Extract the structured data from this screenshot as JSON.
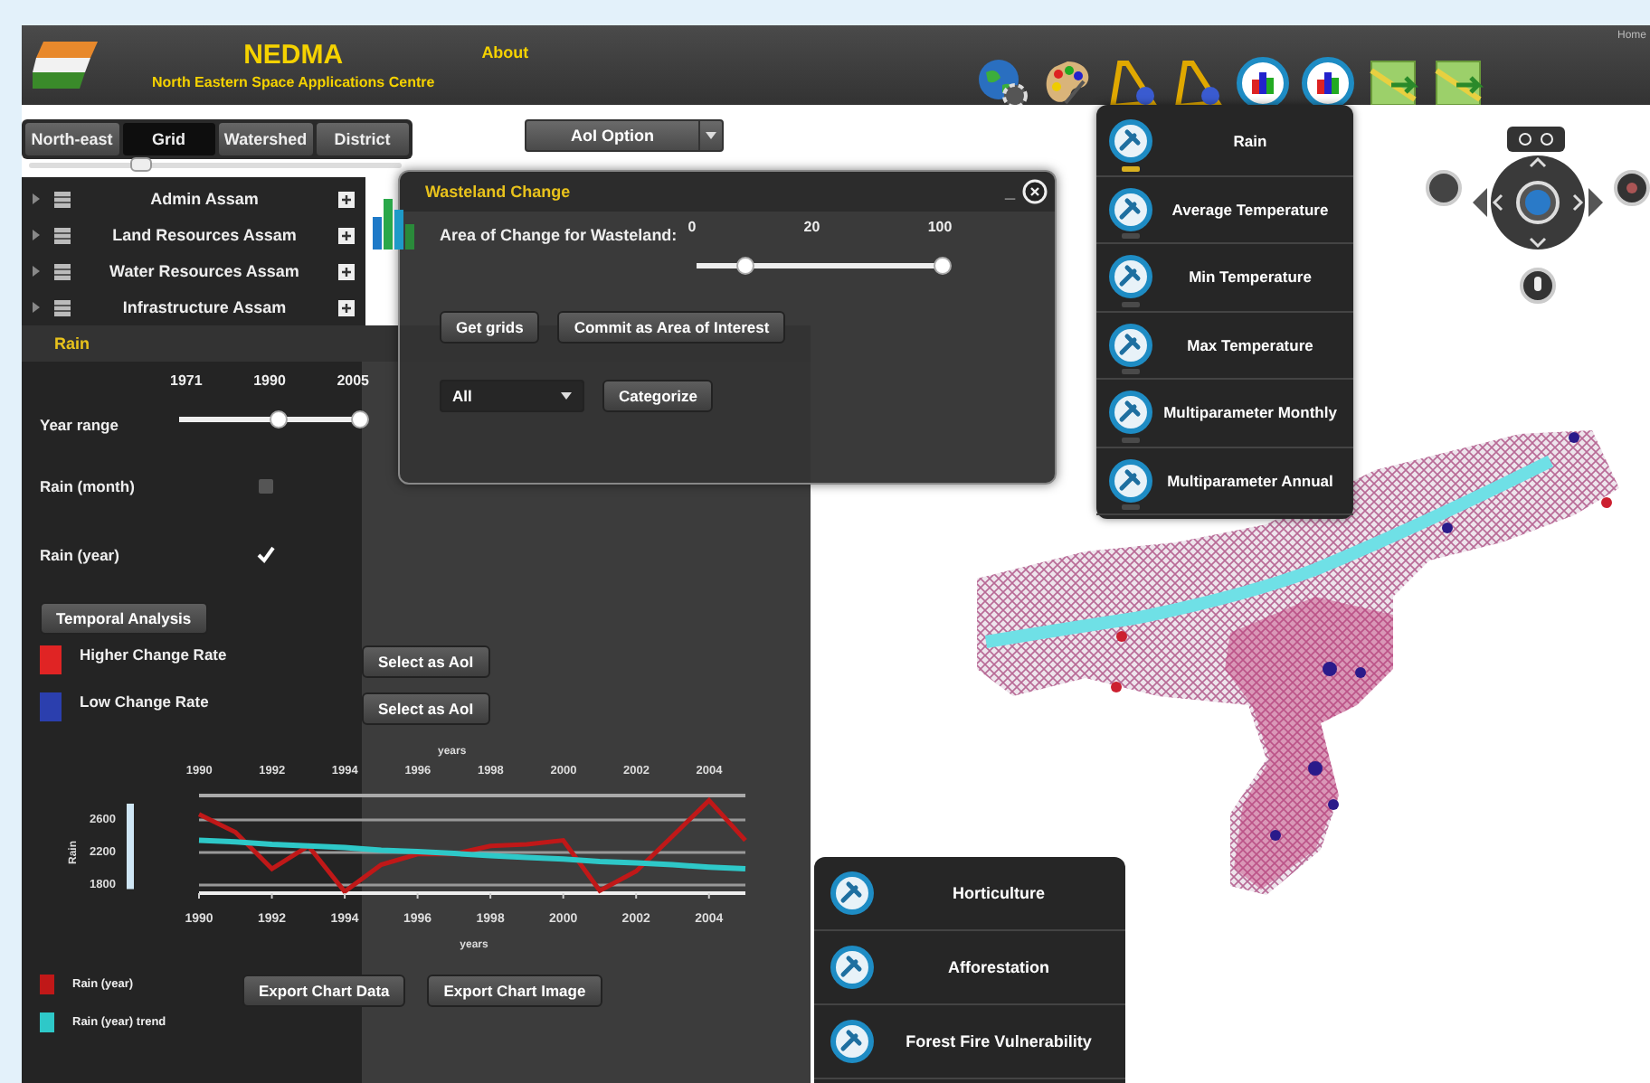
{
  "header": {
    "title": "NEDMA",
    "subtitle": "North Eastern Space Applications Centre",
    "about": "About",
    "home": "Home",
    "tools": [
      {
        "kind": "globe"
      },
      {
        "kind": "palette"
      },
      {
        "kind": "ruler"
      },
      {
        "kind": "ruler"
      },
      {
        "kind": "chart"
      },
      {
        "kind": "chart"
      },
      {
        "kind": "map"
      },
      {
        "kind": "map"
      }
    ]
  },
  "layer_tabs": [
    {
      "label": "North-east",
      "selected": false
    },
    {
      "label": "Grid",
      "selected": true
    },
    {
      "label": "Watershed",
      "selected": false
    },
    {
      "label": "District",
      "selected": false
    }
  ],
  "tabs_slider": {
    "level": 0.3
  },
  "layers": [
    {
      "label": "Admin Assam"
    },
    {
      "label": "Land Resources Assam"
    },
    {
      "label": "Water Resources Assam"
    },
    {
      "label": "Infrastructure Assam"
    }
  ],
  "aoi_option": {
    "label": "AoI Option"
  },
  "wasteland": {
    "title": "Wasteland Change",
    "minimize": "_",
    "label": "Area of Change for Wasteland:",
    "ticks": [
      "0",
      "20",
      "100"
    ],
    "thumbs": [
      {
        "level": 0.2
      },
      {
        "level": 1
      }
    ],
    "buttons": [
      "Get grids",
      "Commit as Area of Interest"
    ],
    "category": "All",
    "categorize": "Categorize"
  },
  "rain": {
    "title": "Rain",
    "ticks": [
      "1971",
      "1990",
      "2005"
    ],
    "year_range": "Year range",
    "thumbs": [
      {
        "level": 0.55
      },
      {
        "level": 1
      }
    ],
    "options": [
      {
        "label": "Rain (month)",
        "checked": false
      },
      {
        "label": "Rain (year)",
        "checked": true
      }
    ],
    "temporal": "Temporal Analysis",
    "change_legend": [
      {
        "label": "Higher Change Rate",
        "color": "#e02424",
        "action": "Select as AoI"
      },
      {
        "label": "Low Change Rate",
        "color": "#2b3fae",
        "action": "Select as AoI"
      }
    ],
    "top_xlabel": "years",
    "top_ticks": [
      "1990",
      "1992",
      "1994",
      "1996",
      "1998",
      "2000",
      "2002",
      "2004"
    ],
    "chart_data": {
      "type": "line",
      "xlabel": "years",
      "ylabel": "Rain",
      "x": [
        1990,
        1991,
        1992,
        1993,
        1994,
        1995,
        1996,
        1997,
        1998,
        1999,
        2000,
        2001,
        2002,
        2003,
        2004,
        2005
      ],
      "series": [
        {
          "name": "Rain (year)",
          "color": "#c01818",
          "values": [
            2670,
            2450,
            2000,
            2280,
            1720,
            2050,
            2180,
            2180,
            2280,
            2300,
            2350,
            1730,
            1970,
            2400,
            2840,
            2350
          ]
        },
        {
          "name": "Rain (year) trend",
          "color": "#2ec8c8",
          "values": [
            2350,
            2330,
            2300,
            2280,
            2260,
            2230,
            2210,
            2190,
            2160,
            2140,
            2120,
            2090,
            2070,
            2050,
            2020,
            2000
          ]
        }
      ],
      "xlim": [
        1990,
        2005
      ],
      "ylim": [
        1700,
        2900
      ],
      "xticks": [
        1990,
        1992,
        1994,
        1996,
        1998,
        2000,
        2002,
        2004
      ],
      "yticks": [
        1800,
        2200,
        2600
      ],
      "grid": true
    },
    "exports": [
      "Export Chart Data",
      "Export Chart Image"
    ]
  },
  "menu": [
    {
      "label": "Rain",
      "selected": true
    },
    {
      "label": "Average Temperature",
      "selected": false
    },
    {
      "label": "Min Temperature",
      "selected": false
    },
    {
      "label": "Max Temperature",
      "selected": false
    },
    {
      "label": "Multiparameter Monthly",
      "selected": false
    },
    {
      "label": "Multiparameter Annual",
      "selected": false
    }
  ],
  "bottom_menu": [
    {
      "label": "Horticulture"
    },
    {
      "label": "Afforestation"
    },
    {
      "label": "Forest Fire Vulnerability"
    }
  ]
}
